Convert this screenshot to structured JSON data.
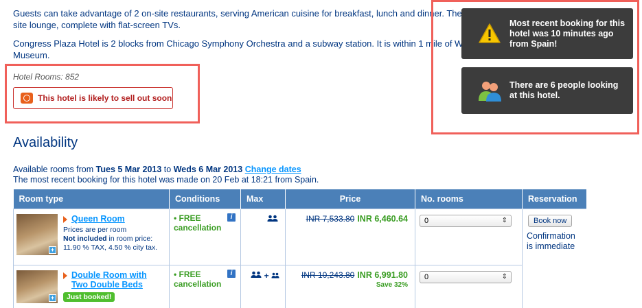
{
  "description": {
    "paragraph1": "Guests can take advantage of 2 on-site restaurants, serving American cuisine for breakfast, lunch and dinner. The hotel also features an on-site lounge, complete with flat-screen TVs.",
    "paragraph2": "Congress Plaza Hotel is 2 blocks from Chicago Symphony Orchestra and a subway station. It is within 1 mile of Willis Tower and Field Museum."
  },
  "hotel_info": {
    "rooms_text": "Hotel Rooms: 852",
    "sellout_text": "This hotel is likely to sell out soon"
  },
  "notifications": [
    {
      "icon": "warning-icon",
      "text": "Most recent booking for this hotel was 10 minutes ago from Spain!"
    },
    {
      "icon": "people-icon",
      "text": "There are 6 people looking at this hotel."
    }
  ],
  "availability": {
    "title": "Availability",
    "rooms_from_label": "Available rooms from ",
    "from_date": "Tues 5 Mar 2013",
    "to_label": " to ",
    "to_date": "Weds 6 Mar 2013",
    "change_dates": "Change dates",
    "recent_booking": "The most recent booking for this hotel was made on 20 Feb at 18:21 from Spain."
  },
  "table": {
    "headers": [
      "Room type",
      "Conditions",
      "Max",
      "Price",
      "No. rooms",
      "Reservation"
    ],
    "rows": [
      {
        "room_name": "Queen Room",
        "note1": "Prices are per room",
        "note2_bold": "Not included",
        "note2_rest": " in room price:",
        "note3": "11.90 % TAX, 4.50 % city tax.",
        "condition": "• FREE cancellation",
        "max_text": "",
        "old_price": "INR 7,533.80",
        "new_price": "INR 6,460.64",
        "save": "",
        "rooms_selected": "0",
        "book_label": "Book now",
        "confirmation": "Confirmation is immediate"
      },
      {
        "room_name": "Double Room with Two Double Beds",
        "badge": "Just booked!",
        "condition": "• FREE cancellation",
        "max_text": "+",
        "old_price": "INR 10,243.80",
        "new_price": "INR 6,991.80",
        "save": "Save 32%",
        "rooms_selected": "0"
      }
    ]
  },
  "colors": {
    "brand_blue": "#003580",
    "link_blue": "#0896ff",
    "header_bg": "#4b80b8",
    "green": "#3a9d23",
    "highlight_red": "#f0605a",
    "toast_bg": "#3c3c3c"
  }
}
